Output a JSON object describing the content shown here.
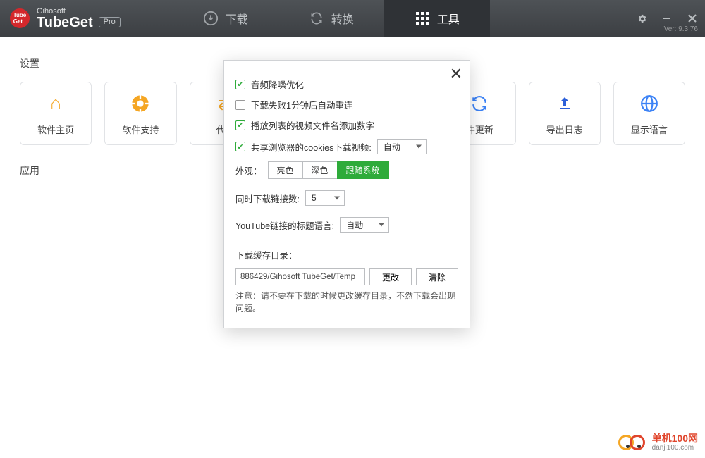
{
  "brand": {
    "small": "Gihosoft",
    "big": "TubeGet",
    "badge": "Pro",
    "version": "Ver: 9.3.76"
  },
  "nav": {
    "download": "下载",
    "convert": "转换",
    "tools": "工具"
  },
  "sections": {
    "settings": "设置",
    "apps": "应用"
  },
  "cards": {
    "home": "软件主页",
    "support": "软件支持",
    "proxy": "代理",
    "update": "件更新",
    "export": "导出日志",
    "language": "显示语言"
  },
  "dialog": {
    "noise": "音频降噪优化",
    "retry": "下载失败1分钟后自动重连",
    "numbering": "播放列表的视频文件名添加数字",
    "cookies": "共享浏览器的cookies下载视频:",
    "cookies_sel": "自动",
    "appearance_label": "外观：",
    "appearance_light": "亮色",
    "appearance_dark": "深色",
    "appearance_system": "跟随系统",
    "concurrent_label": "同时下载链接数:",
    "concurrent_value": "5",
    "yt_lang_label": "YouTube链接的标题语言:",
    "yt_lang_value": "自动",
    "cache_label": "下载缓存目录：",
    "cache_path": "886429/Gihosoft TubeGet/Temp",
    "change": "更改",
    "clear": "清除",
    "note": "注意：请不要在下载的时候更改缓存目录，不然下载会出现问题。"
  },
  "watermark": {
    "cn": "单机100网",
    "url": "danji100.com"
  }
}
